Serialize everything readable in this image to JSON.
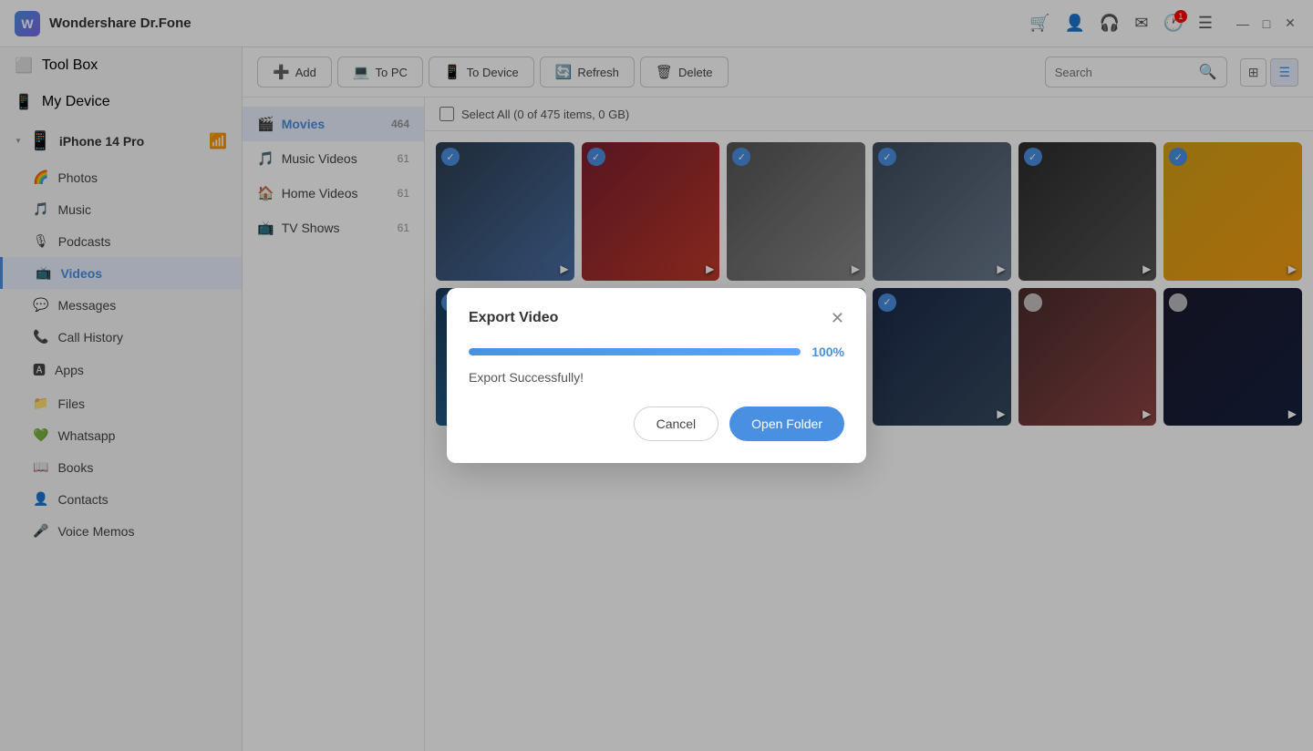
{
  "app": {
    "name": "Wondershare Dr.Fone",
    "logo_letter": "W"
  },
  "titlebar": {
    "cart_icon": "🛒",
    "user_icon": "👤",
    "headset_icon": "🎧",
    "mail_icon": "✉",
    "history_icon": "🕐",
    "list_icon": "☰",
    "minimize": "—",
    "maximize": "□",
    "close": "✕",
    "notification_count": "1"
  },
  "sidebar": {
    "toolbox_label": "Tool Box",
    "toolbox_icon": "⬜",
    "my_device_label": "My Device",
    "my_device_icon": "📱",
    "device_name": "iPhone 14 Pro",
    "device_icon": "📱",
    "wifi_icon": "📶",
    "items": [
      {
        "id": "photos",
        "label": "Photos",
        "icon": "🌈"
      },
      {
        "id": "music",
        "label": "Music",
        "icon": "🎵"
      },
      {
        "id": "podcasts",
        "label": "Podcasts",
        "icon": "🎙"
      },
      {
        "id": "videos",
        "label": "Videos",
        "icon": "📺",
        "active": true
      },
      {
        "id": "messages",
        "label": "Messages",
        "icon": "💬"
      },
      {
        "id": "call-history",
        "label": "Call History",
        "icon": "📞"
      },
      {
        "id": "apps",
        "label": "Apps",
        "icon": "🅰"
      },
      {
        "id": "files",
        "label": "Files",
        "icon": "📁"
      },
      {
        "id": "whatsapp",
        "label": "Whatsapp",
        "icon": "💚"
      },
      {
        "id": "books",
        "label": "Books",
        "icon": "📖"
      },
      {
        "id": "contacts",
        "label": "Contacts",
        "icon": "👤"
      },
      {
        "id": "voice-memos",
        "label": "Voice Memos",
        "icon": "🎤"
      }
    ]
  },
  "toolbar": {
    "add_label": "Add",
    "add_icon": "➕",
    "to_pc_label": "To PC",
    "to_pc_icon": "💻",
    "to_device_label": "To Device",
    "to_device_icon": "📱",
    "refresh_label": "Refresh",
    "refresh_icon": "🔄",
    "delete_label": "Delete",
    "delete_icon": "🗑",
    "search_placeholder": "Search"
  },
  "categories": [
    {
      "id": "movies",
      "label": "Movies",
      "icon": "🎬",
      "count": 464,
      "active": true
    },
    {
      "id": "music-videos",
      "label": "Music Videos",
      "icon": "🎵",
      "count": 61
    },
    {
      "id": "home-videos",
      "label": "Home Videos",
      "icon": "🏠",
      "count": 61
    },
    {
      "id": "tv-shows",
      "label": "TV Shows",
      "icon": "📺",
      "count": 61
    }
  ],
  "content": {
    "select_all_label": "Select All (0 of 475 items, 0 GB)"
  },
  "dialog": {
    "title": "Export Video",
    "progress": 100,
    "progress_label": "100%",
    "success_message": "Export Successfully!",
    "cancel_label": "Cancel",
    "open_folder_label": "Open Folder"
  },
  "thumbnails": [
    {
      "id": 1,
      "class": "t1",
      "checked": true
    },
    {
      "id": 2,
      "class": "t2",
      "checked": true
    },
    {
      "id": 3,
      "class": "t3",
      "checked": true
    },
    {
      "id": 4,
      "class": "t4",
      "checked": true
    },
    {
      "id": 5,
      "class": "t5",
      "checked": true
    },
    {
      "id": 6,
      "class": "t6",
      "checked": true
    },
    {
      "id": 7,
      "class": "t7",
      "checked": true
    },
    {
      "id": 8,
      "class": "t8",
      "checked": false
    },
    {
      "id": 9,
      "class": "t9",
      "checked": false
    },
    {
      "id": 10,
      "class": "t10",
      "checked": true
    },
    {
      "id": 11,
      "class": "t11",
      "checked": false
    },
    {
      "id": 12,
      "class": "t12",
      "checked": false
    }
  ]
}
